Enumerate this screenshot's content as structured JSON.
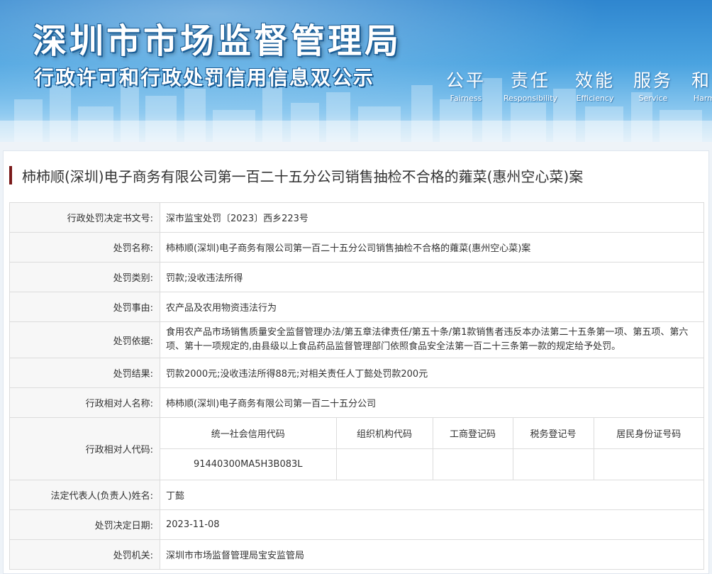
{
  "header": {
    "title": "深圳市市场监督管理局",
    "subtitle": "行政许可和行政处罚信用信息双公示",
    "slogan": [
      {
        "zh": "公平",
        "en": "Fairness"
      },
      {
        "zh": "责任",
        "en": "Responsibility"
      },
      {
        "zh": "效能",
        "en": "Efficiency"
      },
      {
        "zh": "服务",
        "en": "Service"
      },
      {
        "zh": "和谐",
        "en": "Harmony"
      }
    ]
  },
  "case": {
    "title": "柿柿顺(深圳)电子商务有限公司第一百二十五分公司销售抽检不合格的蕹菜(惠州空心菜)案"
  },
  "rows": {
    "decision_no": {
      "label": "行政处罚决定书文号:",
      "value": "深市监宝处罚〔2023〕西乡223号"
    },
    "name": {
      "label": "处罚名称:",
      "value": "柿柿顺(深圳)电子商务有限公司第一百二十五分公司销售抽检不合格的蕹菜(惠州空心菜)案"
    },
    "category": {
      "label": "处罚类别:",
      "value": "罚款;没收违法所得"
    },
    "reason": {
      "label": "处罚事由:",
      "value": "农产品及农用物资违法行为"
    },
    "basis": {
      "label": "处罚依据:",
      "value": "食用农产品市场销售质量安全监督管理办法/第五章法律责任/第五十条/第1款销售者违反本办法第二十五条第一项、第五项、第六项、第十一项规定的,由县级以上食品药品监督管理部门依照食品安全法第一百二十三条第一款的规定给予处罚。"
    },
    "result": {
      "label": "处罚结果:",
      "value": "罚款2000元;没收违法所得88元;对相关责任人丁懿处罚款200元"
    },
    "party_name": {
      "label": "行政相对人名称:",
      "value": "柿柿顺(深圳)电子商务有限公司第一百二十五分公司"
    },
    "party_code": {
      "label": "行政相对人代码:",
      "headers": [
        "统一社会信用代码",
        "组织机构代码",
        "工商登记码",
        "税务登记号",
        "居民身份证号码"
      ],
      "values": [
        "91440300MA5H3B083L",
        "",
        "",
        "",
        ""
      ]
    },
    "legal_rep": {
      "label": "法定代表人(负责人)姓名:",
      "value": "丁懿"
    },
    "date": {
      "label": "处罚决定日期:",
      "value": "2023-11-08"
    },
    "authority": {
      "label": "处罚机关:",
      "value": "深圳市市场监督管理局宝安监管局"
    }
  },
  "colors": {
    "accent_bar": "#7a1a1a",
    "label_bg": "#f7f7f7",
    "banner_top": "#2f86cf"
  }
}
